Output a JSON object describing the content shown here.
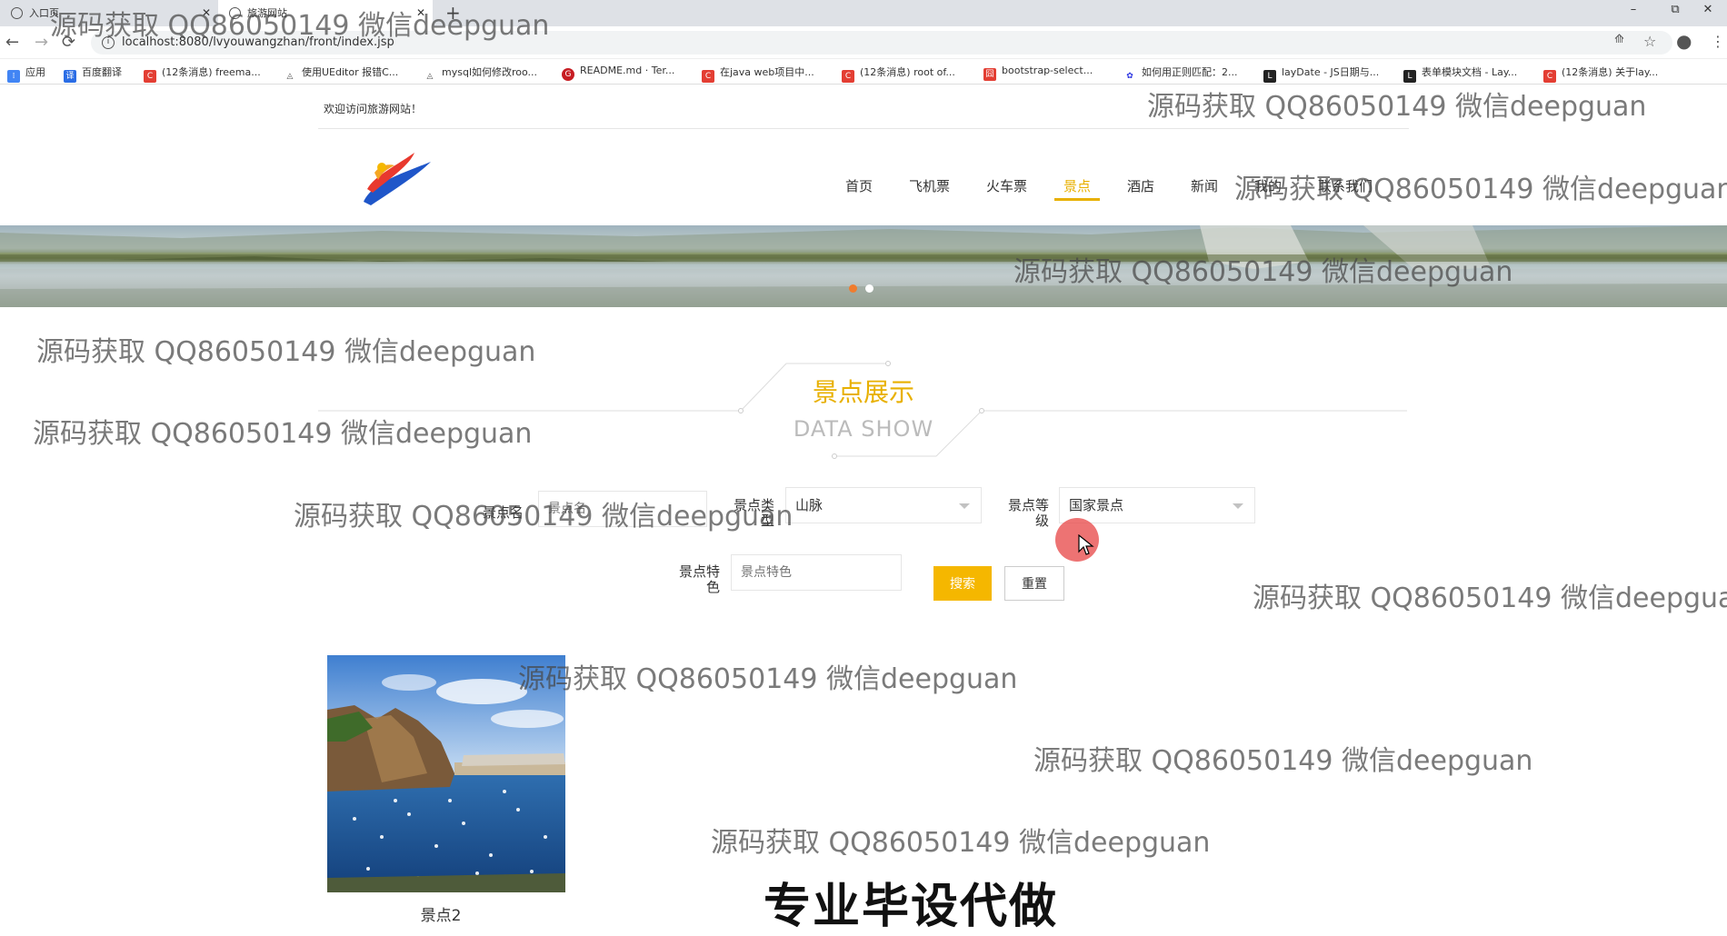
{
  "browser": {
    "tabs": [
      {
        "title": "入口页"
      },
      {
        "title": "旅游网站"
      }
    ],
    "new_tab": "+",
    "window_buttons": [
      "–",
      "⧉",
      "✕"
    ],
    "url": "localhost:8080/lvyouwangzhan/front/index.jsp",
    "bookmarks": [
      {
        "label": "应用",
        "color": "#4285f4"
      },
      {
        "label": "百度翻译",
        "color": "#2b6de5"
      },
      {
        "label": "(12条消息) freema...",
        "color": "#e33e33"
      },
      {
        "label": "使用UEditor 报错C...",
        "color": "#555555"
      },
      {
        "label": "mysql如何修改roo...",
        "color": "#555555"
      },
      {
        "label": "README.md · Ter...",
        "color": "#c71d23"
      },
      {
        "label": "在java web项目中...",
        "color": "#e33e33"
      },
      {
        "label": "(12条消息) root of...",
        "color": "#e33e33"
      },
      {
        "label": "bootstrap-select...",
        "color": "#e33e33"
      },
      {
        "label": "如何用正则匹配：2...",
        "color": "#2932e1"
      },
      {
        "label": "layDate - JS日期与...",
        "color": "#222222"
      },
      {
        "label": "表单模块文档 - Lay...",
        "color": "#222222"
      },
      {
        "label": "(12条消息) 关于lay...",
        "color": "#e33e33"
      }
    ]
  },
  "site": {
    "welcome": "欢迎访问旅游网站！",
    "nav": [
      "首页",
      "飞机票",
      "火车票",
      "景点",
      "酒店",
      "新闻",
      "我的",
      "联系我们"
    ],
    "active_nav": "景点",
    "accent_color": "#e8b000"
  },
  "section": {
    "title": "景点展示",
    "subtitle": "DATA SHOW"
  },
  "search": {
    "name_label": "景点名",
    "name_placeholder": "景点名",
    "type_label": "景点类型",
    "type_value": "山脉",
    "level_label": "景点等级",
    "level_value": "国家景点",
    "feature_label": "景点特色",
    "feature_placeholder": "景点特色",
    "search_button": "搜索",
    "reset_button": "重置"
  },
  "results": [
    {
      "name": "景点2"
    }
  ],
  "watermark": "源码获取 QQ86050149 微信deepguan",
  "overlay_text": "专业毕设代做"
}
